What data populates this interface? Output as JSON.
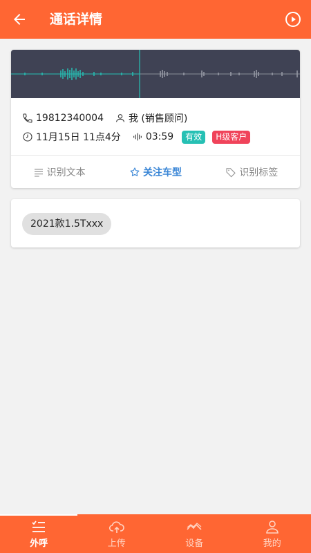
{
  "header": {
    "title": "通话详情",
    "back_icon": "arrow-back-icon",
    "play_icon": "play-circle-icon"
  },
  "call": {
    "phone": "19812340004",
    "user": "我 (销售顾问)",
    "datetime": "11月15日 11点4分",
    "duration": "03:59",
    "badge_valid": "有效",
    "badge_level": "H级客户"
  },
  "actions": [
    {
      "label": "识别文本",
      "icon": "text-lines-icon"
    },
    {
      "label": "关注车型",
      "icon": "star-icon"
    },
    {
      "label": "识别标签",
      "icon": "tag-icon"
    }
  ],
  "tags": [
    "2021款1.5Txxx"
  ],
  "bottom_nav": [
    {
      "label": "外呼",
      "icon": "checklist-icon"
    },
    {
      "label": "上传",
      "icon": "cloud-upload-icon"
    },
    {
      "label": "设备",
      "icon": "device-icon"
    },
    {
      "label": "我的",
      "icon": "person-icon"
    }
  ],
  "colors": {
    "accent": "#ff6633",
    "wave_bg": "#3f4254",
    "wave_active": "#26c0b4",
    "valid": "#26c0b4",
    "level": "#f0435a",
    "link": "#3a86d6"
  }
}
